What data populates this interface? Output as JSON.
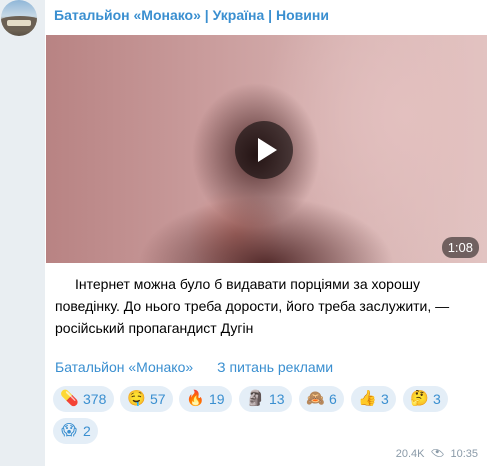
{
  "channel": {
    "title": "Батальйон «Монако» | Україна | Новини"
  },
  "video": {
    "duration": "1:08"
  },
  "post": {
    "text": "Інтернет можна було б видавати порціями за хорошу поведінку. До нього треба дорости, його треба заслужити, — російський пропагандист Дугін"
  },
  "links": [
    "Батальйон «Монако»",
    "З питань реклами"
  ],
  "reactions": [
    {
      "emoji": "💊",
      "count": "378"
    },
    {
      "emoji": "🤤",
      "count": "57"
    },
    {
      "emoji": "🔥",
      "count": "19"
    },
    {
      "emoji": "🗿",
      "count": "13"
    },
    {
      "emoji": "🙈",
      "count": "6"
    },
    {
      "emoji": "👍",
      "count": "3"
    },
    {
      "emoji": "🤔",
      "count": "3"
    },
    {
      "emoji": "😱",
      "count": "2"
    }
  ],
  "meta": {
    "views": "20.4K",
    "time": "10:35"
  }
}
